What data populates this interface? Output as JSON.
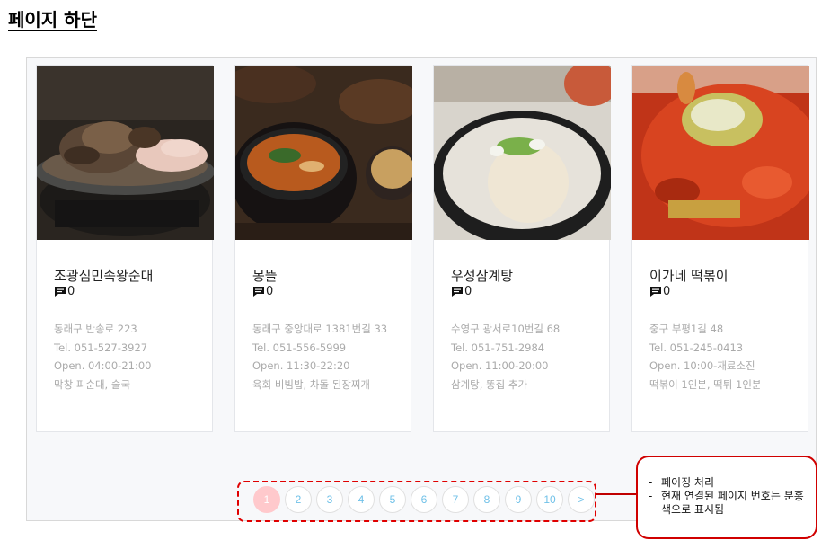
{
  "page_title": "페이지 하단",
  "cards": [
    {
      "name": "조광심민속왕순대",
      "comment_count": "0",
      "address": "동래구 반송로 223",
      "tel": "Tel. 051-527-3927",
      "hours": "Open. 04:00-21:00",
      "menu": "막창 피순대, 술국",
      "image_icon": "sundae-plate-photo"
    },
    {
      "name": "몽뜰",
      "comment_count": "0",
      "address": "동래구 중앙대로 1381번길 33",
      "tel": "Tel. 051-556-5999",
      "hours": "Open. 11:30-22:20",
      "menu": "육회 비빔밥, 차돌 된장찌개",
      "image_icon": "doenjang-stew-photo"
    },
    {
      "name": "우성삼계탕",
      "comment_count": "0",
      "address": "수영구 광서로10번길 68",
      "tel": "Tel. 051-751-2984",
      "hours": "Open. 11:00-20:00",
      "menu": "삼계탕, 똥집 추가",
      "image_icon": "samgyetang-photo"
    },
    {
      "name": "이가네 떡볶이",
      "comment_count": "0",
      "address": "중구 부평1길 48",
      "tel": "Tel. 051-245-0413",
      "hours": "Open. 10:00-재료소진",
      "menu": "떡볶이 1인분, 떡튀 1인분",
      "image_icon": "tteokbokki-photo"
    }
  ],
  "pagination": {
    "pages": [
      "1",
      "2",
      "3",
      "4",
      "5",
      "6",
      "7",
      "8",
      "9",
      "10"
    ],
    "next": ">",
    "current": "1"
  },
  "annotation": {
    "notes": [
      "페이징 처리",
      "현재 연결된 페이지 번호는 분홍색으로 표시됨"
    ]
  },
  "colors": {
    "active_page": "#ffc9cc",
    "page_text": "#70c1e8",
    "annotation_border": "#d00000"
  }
}
